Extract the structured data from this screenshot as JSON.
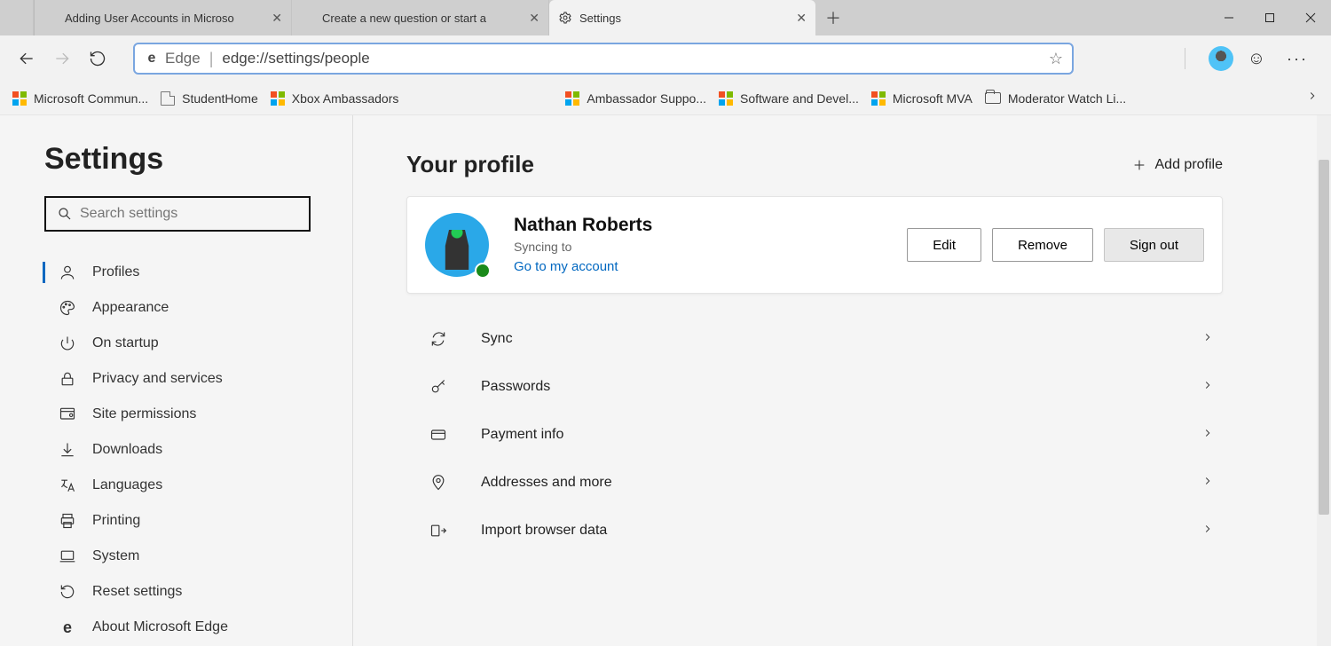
{
  "window": {
    "tabs": [
      {
        "title": "Adding User Accounts in Microso"
      },
      {
        "title": "Create a new question or start a"
      },
      {
        "title": "Settings"
      }
    ],
    "active_tab_index": 2
  },
  "toolbar": {
    "proto_label": "Edge",
    "url": "edge://settings/people"
  },
  "favorites": [
    "Microsoft Commun...",
    "StudentHome",
    "Xbox Ambassadors",
    "Ambassador Suppo...",
    "Software and Devel...",
    "Microsoft MVA",
    "Moderator Watch Li..."
  ],
  "sidebar": {
    "title": "Settings",
    "search_placeholder": "Search settings",
    "items": [
      "Profiles",
      "Appearance",
      "On startup",
      "Privacy and services",
      "Site permissions",
      "Downloads",
      "Languages",
      "Printing",
      "System",
      "Reset settings",
      "About Microsoft Edge"
    ],
    "selected_index": 0
  },
  "main": {
    "heading": "Your profile",
    "add_profile_label": "Add profile",
    "profile": {
      "name": "Nathan Roberts",
      "status": "Syncing to",
      "account_link": "Go to my account",
      "buttons": {
        "edit": "Edit",
        "remove": "Remove",
        "signout": "Sign out"
      }
    },
    "rows": [
      "Sync",
      "Passwords",
      "Payment info",
      "Addresses and more",
      "Import browser data"
    ]
  }
}
